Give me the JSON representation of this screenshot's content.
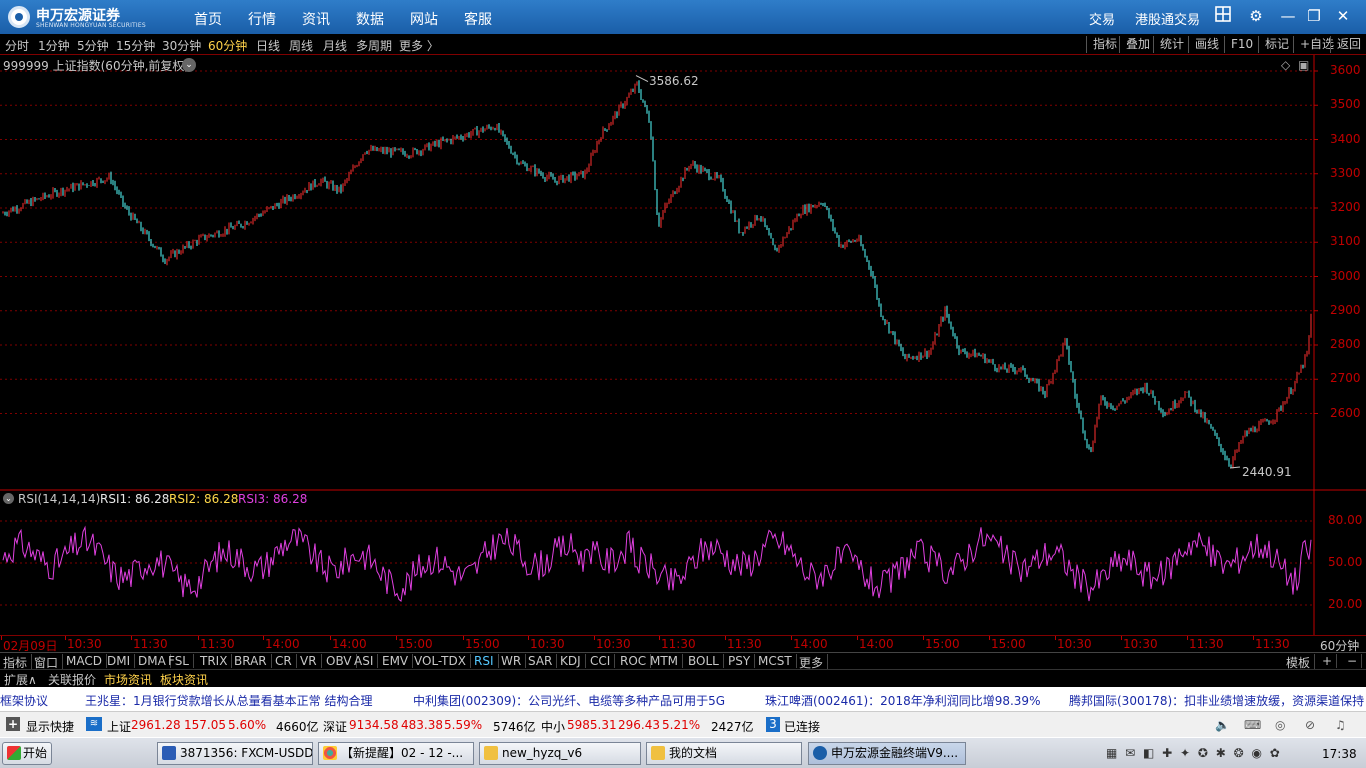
{
  "app": {
    "logo_text": "申万宏源证券",
    "logo_en": "SHENWAN HONGYUAN SECURITIES",
    "menu": [
      "首页",
      "行情",
      "资讯",
      "数据",
      "网站",
      "客服"
    ],
    "right_links": [
      "交易",
      "港股通交易"
    ]
  },
  "periods": [
    "分时",
    "1分钟",
    "5分钟",
    "15分钟",
    "30分钟",
    "60分钟",
    "日线",
    "周线",
    "月线",
    "多周期",
    "更多 〉"
  ],
  "active_period": "60分钟",
  "right_tools": [
    "指标",
    "叠加",
    "统计",
    "画线",
    "F10",
    "标记",
    "+自选",
    "返回"
  ],
  "main_chart": {
    "title": "999999 上证指数(60分钟,前复权)",
    "high_label": "3586.62",
    "low_label": "2440.91",
    "y_ticks": [
      "3600",
      "3500",
      "3400",
      "3300",
      "3200",
      "3100",
      "3000",
      "2900",
      "2800",
      "2700",
      "2600"
    ]
  },
  "rsi": {
    "title": "RSI(14,14,14)",
    "rsi1": "RSI1: 86.28",
    "rsi2": "RSI2: 86.28",
    "rsi3": "RSI3: 86.28",
    "y_ticks": [
      "80.00",
      "50.00",
      "20.00"
    ]
  },
  "time_axis": [
    "02月09日",
    "10:30",
    "11:30",
    "11:30",
    "14:00",
    "14:00",
    "15:00",
    "15:00",
    "10:30",
    "10:30",
    "11:30",
    "11:30",
    "14:00",
    "14:00",
    "15:00",
    "15:00",
    "10:30",
    "10:30",
    "11:30",
    "11:30"
  ],
  "period_label": "60分钟",
  "indicator_tabs": [
    "指标",
    "窗口",
    "MACD",
    "DMI",
    "DMA",
    "FSL",
    "TRIX",
    "BRAR",
    "CR",
    "VR",
    "OBV",
    "ASI",
    "EMV",
    "VOL-TDX",
    "RSI",
    "WR",
    "SAR",
    "KDJ",
    "CCI",
    "ROC",
    "MTM",
    "BOLL",
    "PSY",
    "MCST",
    "更多"
  ],
  "active_indicator": "RSI",
  "template_label": "模板",
  "sub_tabs": [
    "扩展∧",
    "关联报价",
    "市场资讯",
    "板块资讯"
  ],
  "news": [
    "框架协议",
    "王兆星：1月银行贷款增长从总量看基本正常 结构合理",
    "中利集团(002309)：公司光纤、电缆等多种产品可用于5G",
    "珠江啤酒(002461)：2018年净利润同比增98.39%",
    "腾邦国际(300178)：扣非业绩增速放缓，资源渠道保持"
  ],
  "status": {
    "show_shortcut": "显示快捷",
    "sh_label": "上证",
    "sh_value": "2961.28",
    "sh_change": "157.05",
    "sh_pct": "5.60%",
    "sh_volume": "4660亿",
    "sz_label": "深证",
    "sz_value": "9134.58",
    "sz_change": "483.38",
    "sz_pct": "5.59%",
    "sz_volume": "5746亿",
    "zx_label": "中小",
    "zx_value": "5985.31",
    "zx_change": "296.43",
    "zx_pct": "5.21%",
    "zx_volume": "2427亿",
    "conn_num": "3",
    "conn_text": "已连接"
  },
  "taskbar": {
    "start": "开始",
    "tasks": [
      "3871356: FXCM-USDDe...",
      "【新提醒】02 - 12 -...",
      "new_hyzq_v6",
      "我的文档",
      "申万宏源金融终端V9...."
    ],
    "clock": "17:38"
  },
  "colors": {
    "up": "#ff3030",
    "down": "#54ffff",
    "rsi": "#e040e0",
    "grid": "#800000"
  }
}
